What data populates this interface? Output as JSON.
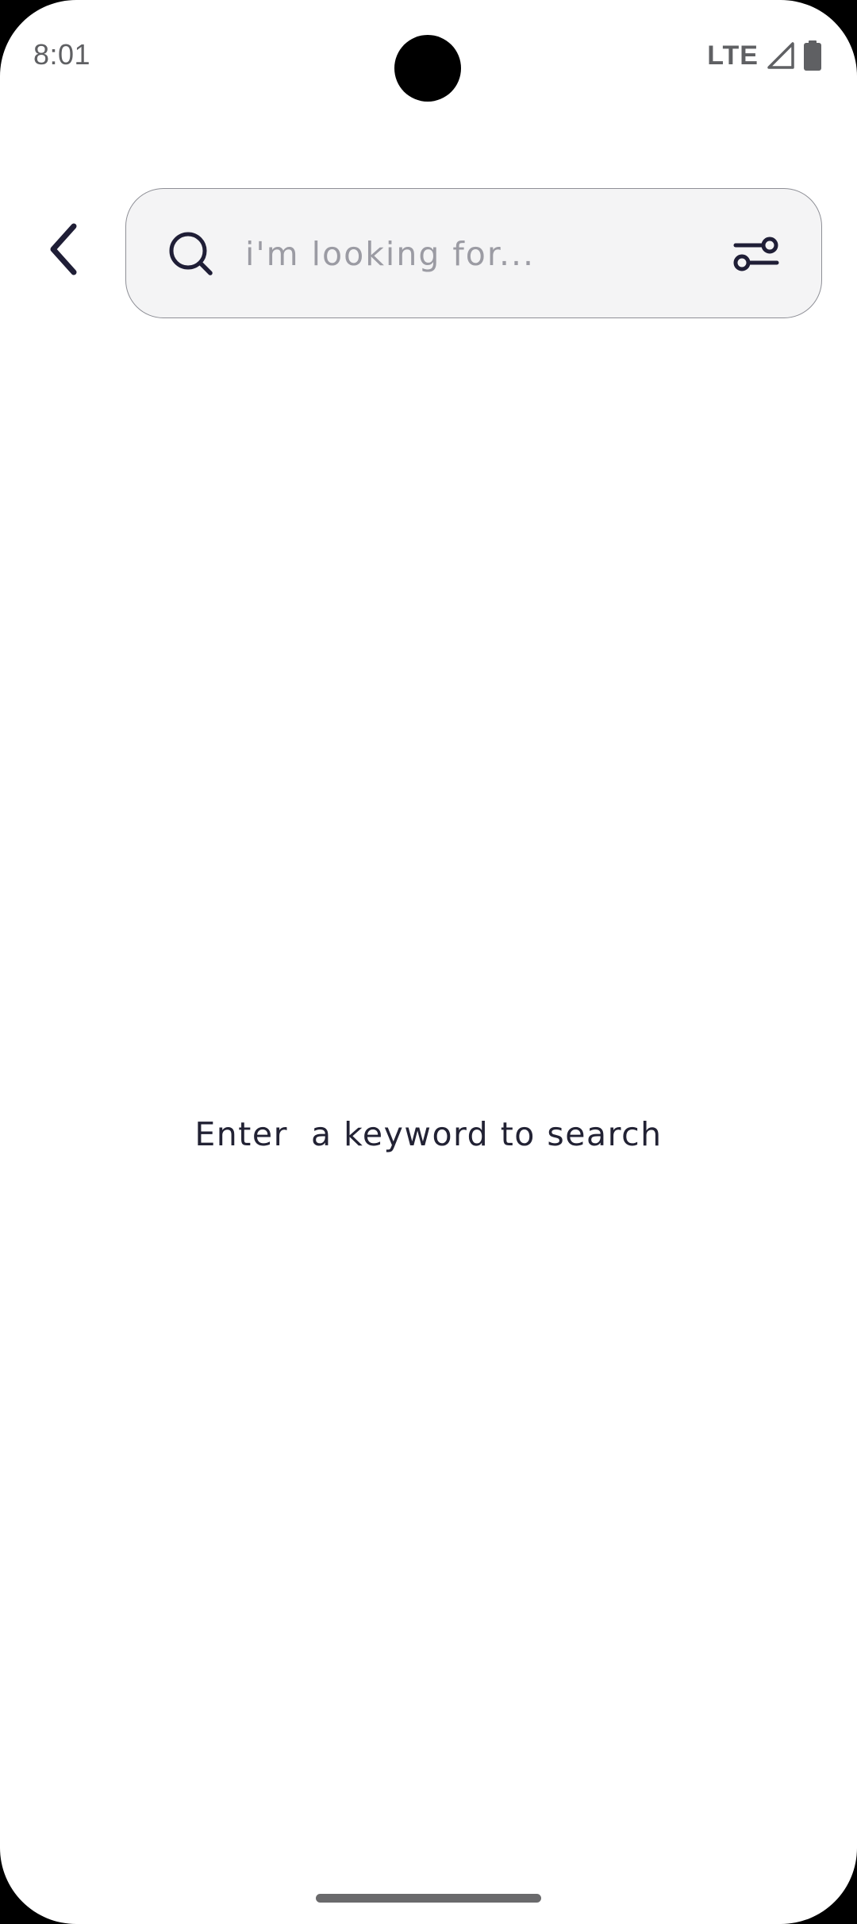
{
  "status_bar": {
    "time": "8:01",
    "network": "LTE",
    "icons": [
      "signal-icon",
      "battery-icon"
    ]
  },
  "header": {
    "back_icon": "chevron-left-icon",
    "search": {
      "placeholder": "i'm looking for...",
      "value": "",
      "search_icon": "search-icon",
      "filter_icon": "filter-sliders-icon"
    }
  },
  "main": {
    "empty_message": "Enter  a keyword to search"
  },
  "colors": {
    "text_dark": "#1f1e36",
    "placeholder": "#9b9ba3",
    "search_bg": "#f4f4f5",
    "search_border": "#8e8f96"
  }
}
